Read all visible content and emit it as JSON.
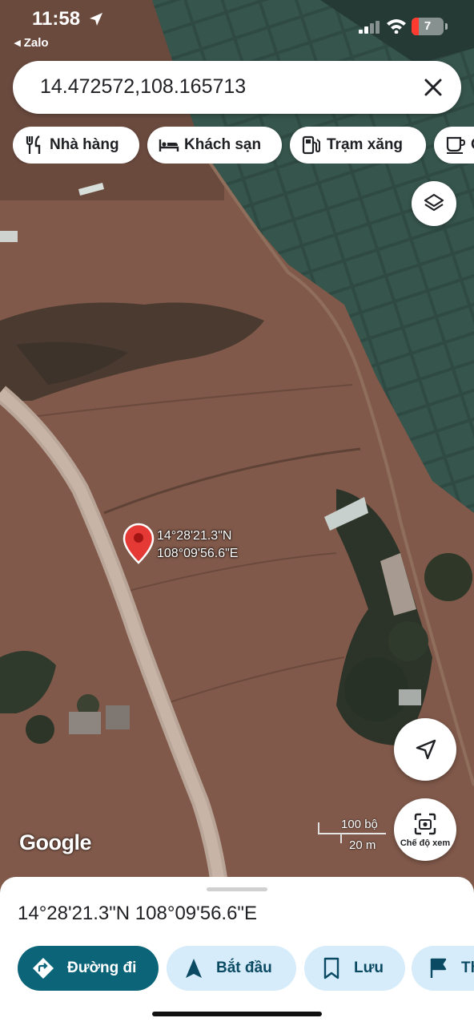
{
  "status_bar": {
    "time": "11:58",
    "back_app": "◂ Zalo",
    "battery_level": "7"
  },
  "search": {
    "query": "14.472572,108.165713"
  },
  "chips": [
    {
      "label": "Nhà hàng",
      "icon": "restaurant-icon"
    },
    {
      "label": "Khách sạn",
      "icon": "hotel-icon"
    },
    {
      "label": "Trạm xăng",
      "icon": "gas-station-icon"
    },
    {
      "label": "C",
      "icon": "coffee-icon"
    }
  ],
  "pin": {
    "lat_label": "14°28'21.3\"N",
    "lng_label": "108°09'56.6\"E"
  },
  "map_controls": {
    "layers_icon": "layers-icon",
    "navigate_icon": "navigation-arrow-icon",
    "view_mode_label": "Chế độ xem",
    "scale_top": "100 bộ",
    "scale_bottom": "20 m",
    "attribution": "Google"
  },
  "sheet": {
    "coordinates": "14°28'21.3\"N 108°09'56.6\"E",
    "actions": [
      {
        "label": "Đường đi",
        "icon": "directions-icon",
        "primary": true
      },
      {
        "label": "Bắt đầu",
        "icon": "start-navigation-icon"
      },
      {
        "label": "Lưu",
        "icon": "bookmark-icon"
      },
      {
        "label": "Th",
        "icon": "flag-icon"
      }
    ]
  },
  "colors": {
    "primary_button": "#0b6478",
    "secondary_button": "#d6ecfa",
    "pin": "#e53935"
  }
}
